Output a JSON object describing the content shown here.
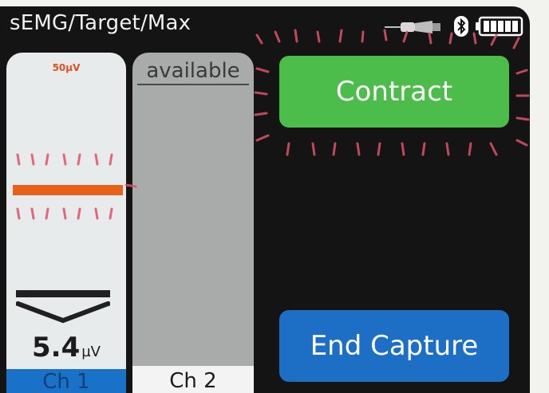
{
  "header": {
    "title": "sEMG/Target/Max",
    "icons": [
      "sensor-probe-icon",
      "bluetooth-icon",
      "battery-full-icon"
    ]
  },
  "channel1": {
    "reference_label": "50µV",
    "value": "5.4",
    "unit": "µV",
    "label": "Ch 1"
  },
  "channel2": {
    "status": "available",
    "label": "Ch 2"
  },
  "buttons": {
    "contract": "Contract",
    "end_capture": "End Capture"
  },
  "colors": {
    "contract_green": "#4cbc4a",
    "end_capture_blue": "#1d6fc6",
    "target_orange": "#e5621a",
    "flash_ticks": "#e0506a"
  }
}
